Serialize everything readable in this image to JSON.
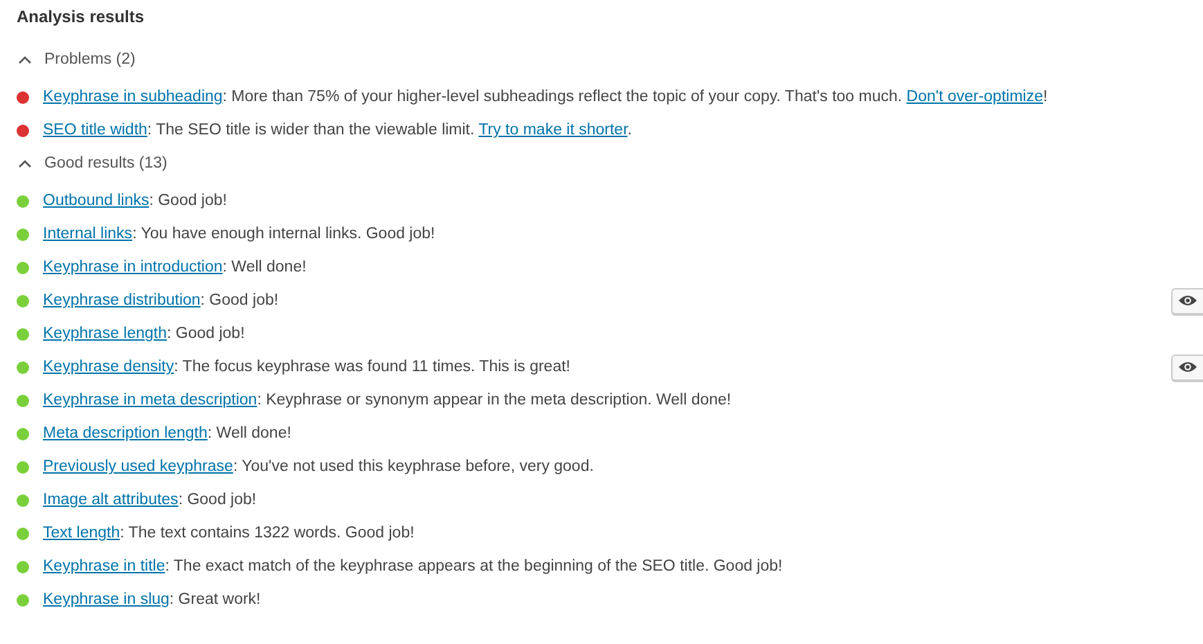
{
  "title": "Analysis results",
  "sections": [
    {
      "heading": "Problems (2)",
      "expanded": true,
      "items": [
        {
          "color": "#dc3232",
          "eye_button": false,
          "segments": [
            {
              "kind": "link",
              "text": "Keyphrase in subheading"
            },
            {
              "kind": "text",
              "text": ": More than 75% of your higher-level subheadings reflect the topic of your copy. That's too much. "
            },
            {
              "kind": "link",
              "text": "Don't over-optimize"
            },
            {
              "kind": "text",
              "text": "!"
            }
          ]
        },
        {
          "color": "#dc3232",
          "eye_button": false,
          "segments": [
            {
              "kind": "link",
              "text": "SEO title width"
            },
            {
              "kind": "text",
              "text": ": The SEO title is wider than the viewable limit. "
            },
            {
              "kind": "link",
              "text": "Try to make it shorter"
            },
            {
              "kind": "text",
              "text": "."
            }
          ]
        }
      ]
    },
    {
      "heading": "Good results (13)",
      "expanded": true,
      "items": [
        {
          "color": "#7ad03a",
          "eye_button": false,
          "segments": [
            {
              "kind": "link",
              "text": "Outbound links"
            },
            {
              "kind": "text",
              "text": ": Good job!"
            }
          ]
        },
        {
          "color": "#7ad03a",
          "eye_button": false,
          "segments": [
            {
              "kind": "link",
              "text": "Internal links"
            },
            {
              "kind": "text",
              "text": ": You have enough internal links. Good job!"
            }
          ]
        },
        {
          "color": "#7ad03a",
          "eye_button": false,
          "segments": [
            {
              "kind": "link",
              "text": "Keyphrase in introduction"
            },
            {
              "kind": "text",
              "text": ": Well done!"
            }
          ]
        },
        {
          "color": "#7ad03a",
          "eye_button": true,
          "segments": [
            {
              "kind": "link",
              "text": "Keyphrase distribution"
            },
            {
              "kind": "text",
              "text": ": Good job!"
            }
          ]
        },
        {
          "color": "#7ad03a",
          "eye_button": false,
          "segments": [
            {
              "kind": "link",
              "text": "Keyphrase length"
            },
            {
              "kind": "text",
              "text": ": Good job!"
            }
          ]
        },
        {
          "color": "#7ad03a",
          "eye_button": true,
          "segments": [
            {
              "kind": "link",
              "text": "Keyphrase density"
            },
            {
              "kind": "text",
              "text": ": The focus keyphrase was found 11 times. This is great!"
            }
          ]
        },
        {
          "color": "#7ad03a",
          "eye_button": false,
          "segments": [
            {
              "kind": "link",
              "text": "Keyphrase in meta description"
            },
            {
              "kind": "text",
              "text": ": Keyphrase or synonym appear in the meta description. Well done!"
            }
          ]
        },
        {
          "color": "#7ad03a",
          "eye_button": false,
          "segments": [
            {
              "kind": "link",
              "text": "Meta description length"
            },
            {
              "kind": "text",
              "text": ": Well done!"
            }
          ]
        },
        {
          "color": "#7ad03a",
          "eye_button": false,
          "segments": [
            {
              "kind": "link",
              "text": "Previously used keyphrase"
            },
            {
              "kind": "text",
              "text": ": You've not used this keyphrase before, very good."
            }
          ]
        },
        {
          "color": "#7ad03a",
          "eye_button": false,
          "segments": [
            {
              "kind": "link",
              "text": "Image alt attributes"
            },
            {
              "kind": "text",
              "text": ": Good job!"
            }
          ]
        },
        {
          "color": "#7ad03a",
          "eye_button": false,
          "segments": [
            {
              "kind": "link",
              "text": "Text length"
            },
            {
              "kind": "text",
              "text": ": The text contains 1322 words. Good job!"
            }
          ]
        },
        {
          "color": "#7ad03a",
          "eye_button": false,
          "segments": [
            {
              "kind": "link",
              "text": "Keyphrase in title"
            },
            {
              "kind": "text",
              "text": ": The exact match of the keyphrase appears at the beginning of the SEO title. Good job!"
            }
          ]
        },
        {
          "color": "#7ad03a",
          "eye_button": false,
          "segments": [
            {
              "kind": "link",
              "text": "Keyphrase in slug"
            },
            {
              "kind": "text",
              "text": ": Great work!"
            }
          ]
        }
      ]
    }
  ]
}
